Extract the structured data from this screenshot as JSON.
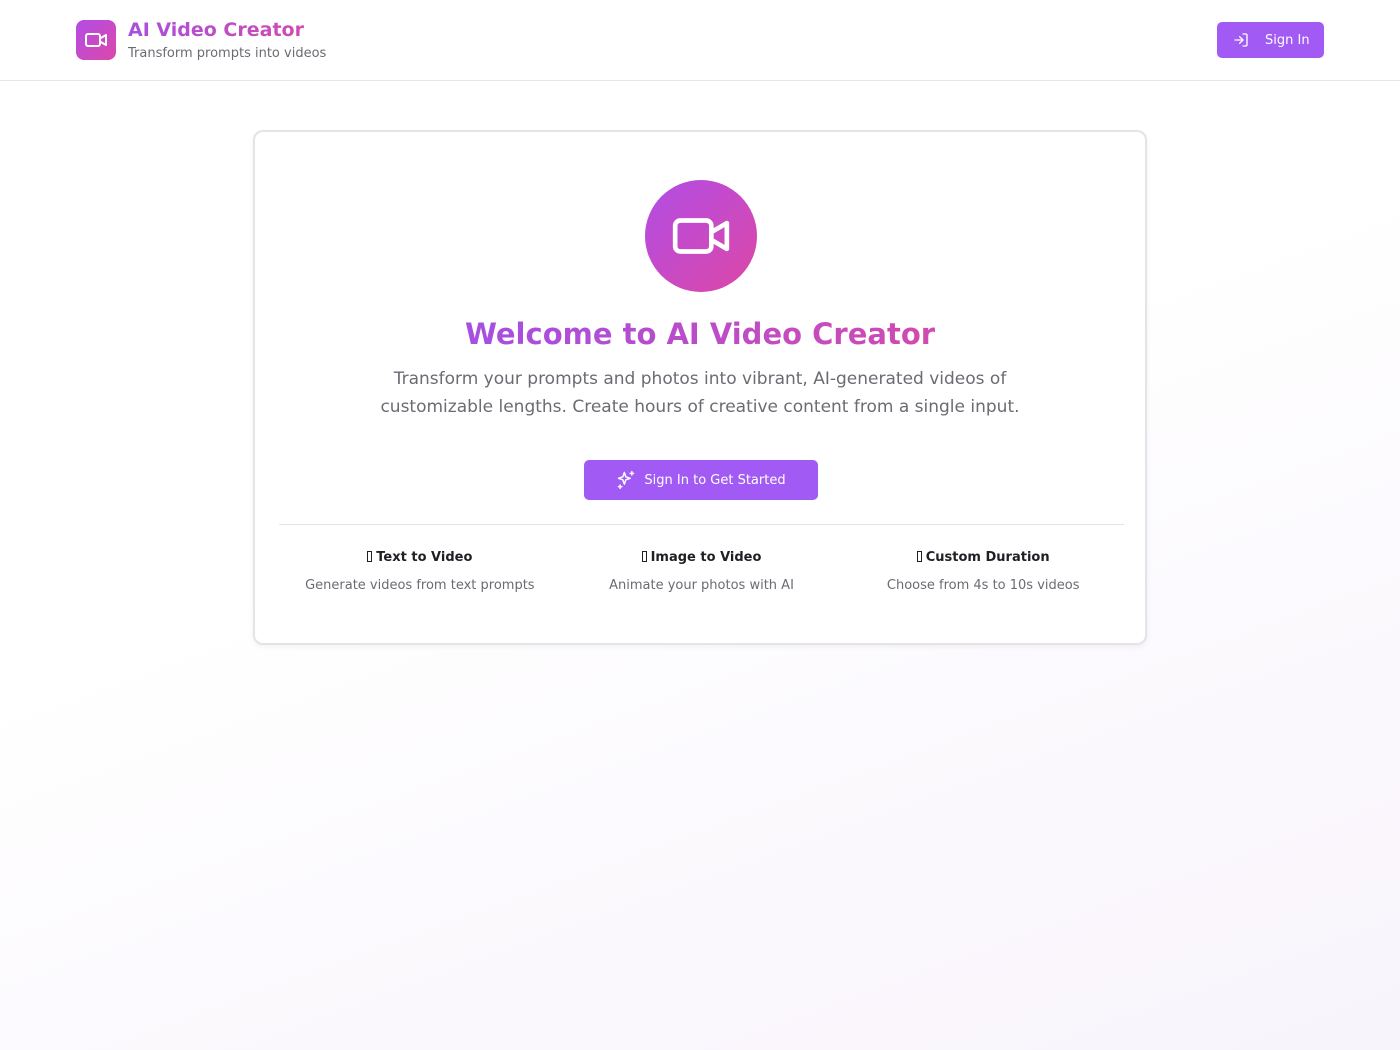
{
  "header": {
    "title": "AI Video Creator",
    "subtitle": "Transform prompts into videos",
    "sign_in_label": "Sign In",
    "logo_icon": "video-camera-icon",
    "sign_in_icon": "log-in-icon"
  },
  "welcome": {
    "hero_icon": "video-camera-icon",
    "title": "Welcome to AI Video Creator",
    "description": "Transform your prompts and photos into vibrant, AI-generated videos of customizable lengths. Create hours of creative content from a single input.",
    "cta_label": "Sign In to Get Started",
    "cta_icon": "sparkles-icon"
  },
  "features": [
    {
      "title": "Text to Video",
      "description": "Generate videos from text prompts"
    },
    {
      "title": "Image to Video",
      "description": "Animate your photos with AI"
    },
    {
      "title": "Custom Duration",
      "description": "Choose from 4s to 10s videos"
    }
  ],
  "colors": {
    "accent": "#a25af4",
    "gradient_start": "#b14de6",
    "gradient_end": "#dc48a8",
    "muted_text": "#6b6b73"
  }
}
